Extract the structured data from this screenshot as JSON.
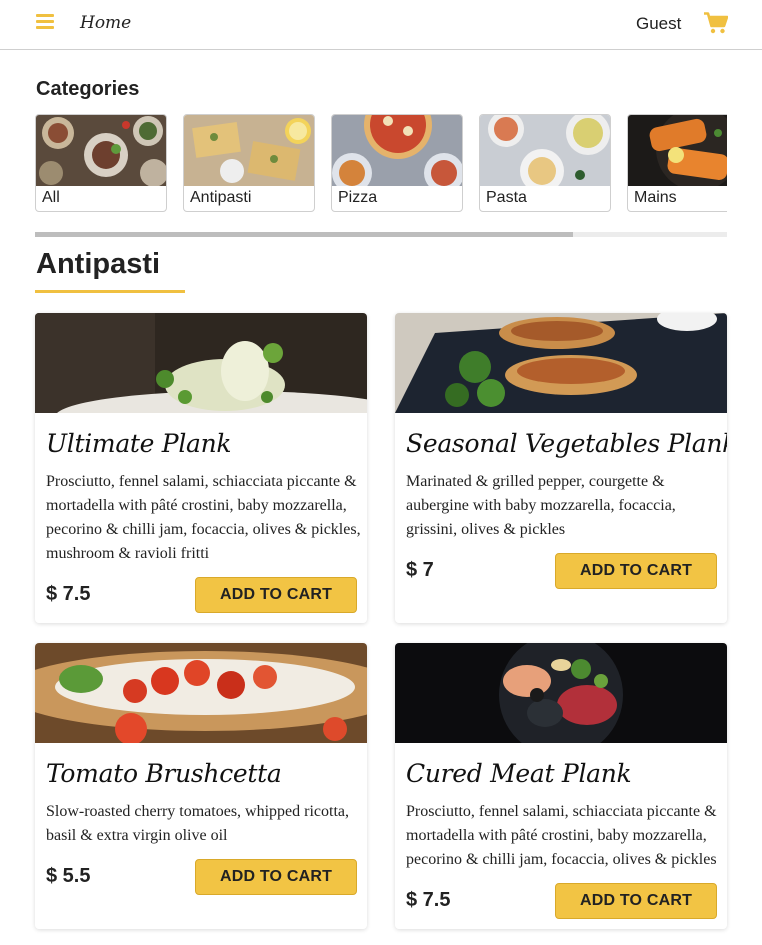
{
  "header": {
    "home_label": "Home",
    "user_label": "Guest",
    "accent_color": "#f0c040",
    "menu_icon": "hamburger-menu-icon",
    "cart_icon": "shopping-cart-icon"
  },
  "categories": {
    "title": "Categories",
    "items": [
      {
        "label": "All"
      },
      {
        "label": "Antipasti"
      },
      {
        "label": "Pizza"
      },
      {
        "label": "Pasta"
      },
      {
        "label": "Mains"
      }
    ]
  },
  "section": {
    "title": "Antipasti"
  },
  "products": [
    {
      "name": "Ultimate Plank",
      "description": "Prosciutto, fennel salami, schiacciata piccante & mortadella with pâté crostini, baby mozzarella, pecorino & chilli jam, focaccia, olives & pickles, mushroom & ravioli fritti",
      "price": "$ 7.5",
      "button_label": "ADD TO CART"
    },
    {
      "name": "Seasonal Vegetables Plank",
      "description": "Marinated & grilled pepper, courgette & aubergine with baby mozzarella, focaccia, grissini, olives & pickles",
      "price": "$ 7",
      "button_label": "ADD TO CART"
    },
    {
      "name": "Tomato Brushcetta",
      "description": "Slow-roasted cherry tomatoes, whipped ricotta, basil & extra virgin olive oil",
      "price": "$ 5.5",
      "button_label": "ADD TO CART"
    },
    {
      "name": "Cured Meat Plank",
      "description": "Prosciutto, fennel salami, schiacciata piccante & mortadella with pâté crostini, baby mozzarella, pecorino & chilli jam, focaccia, olives & pickles",
      "price": "$ 7.5",
      "button_label": "ADD TO CART"
    }
  ]
}
